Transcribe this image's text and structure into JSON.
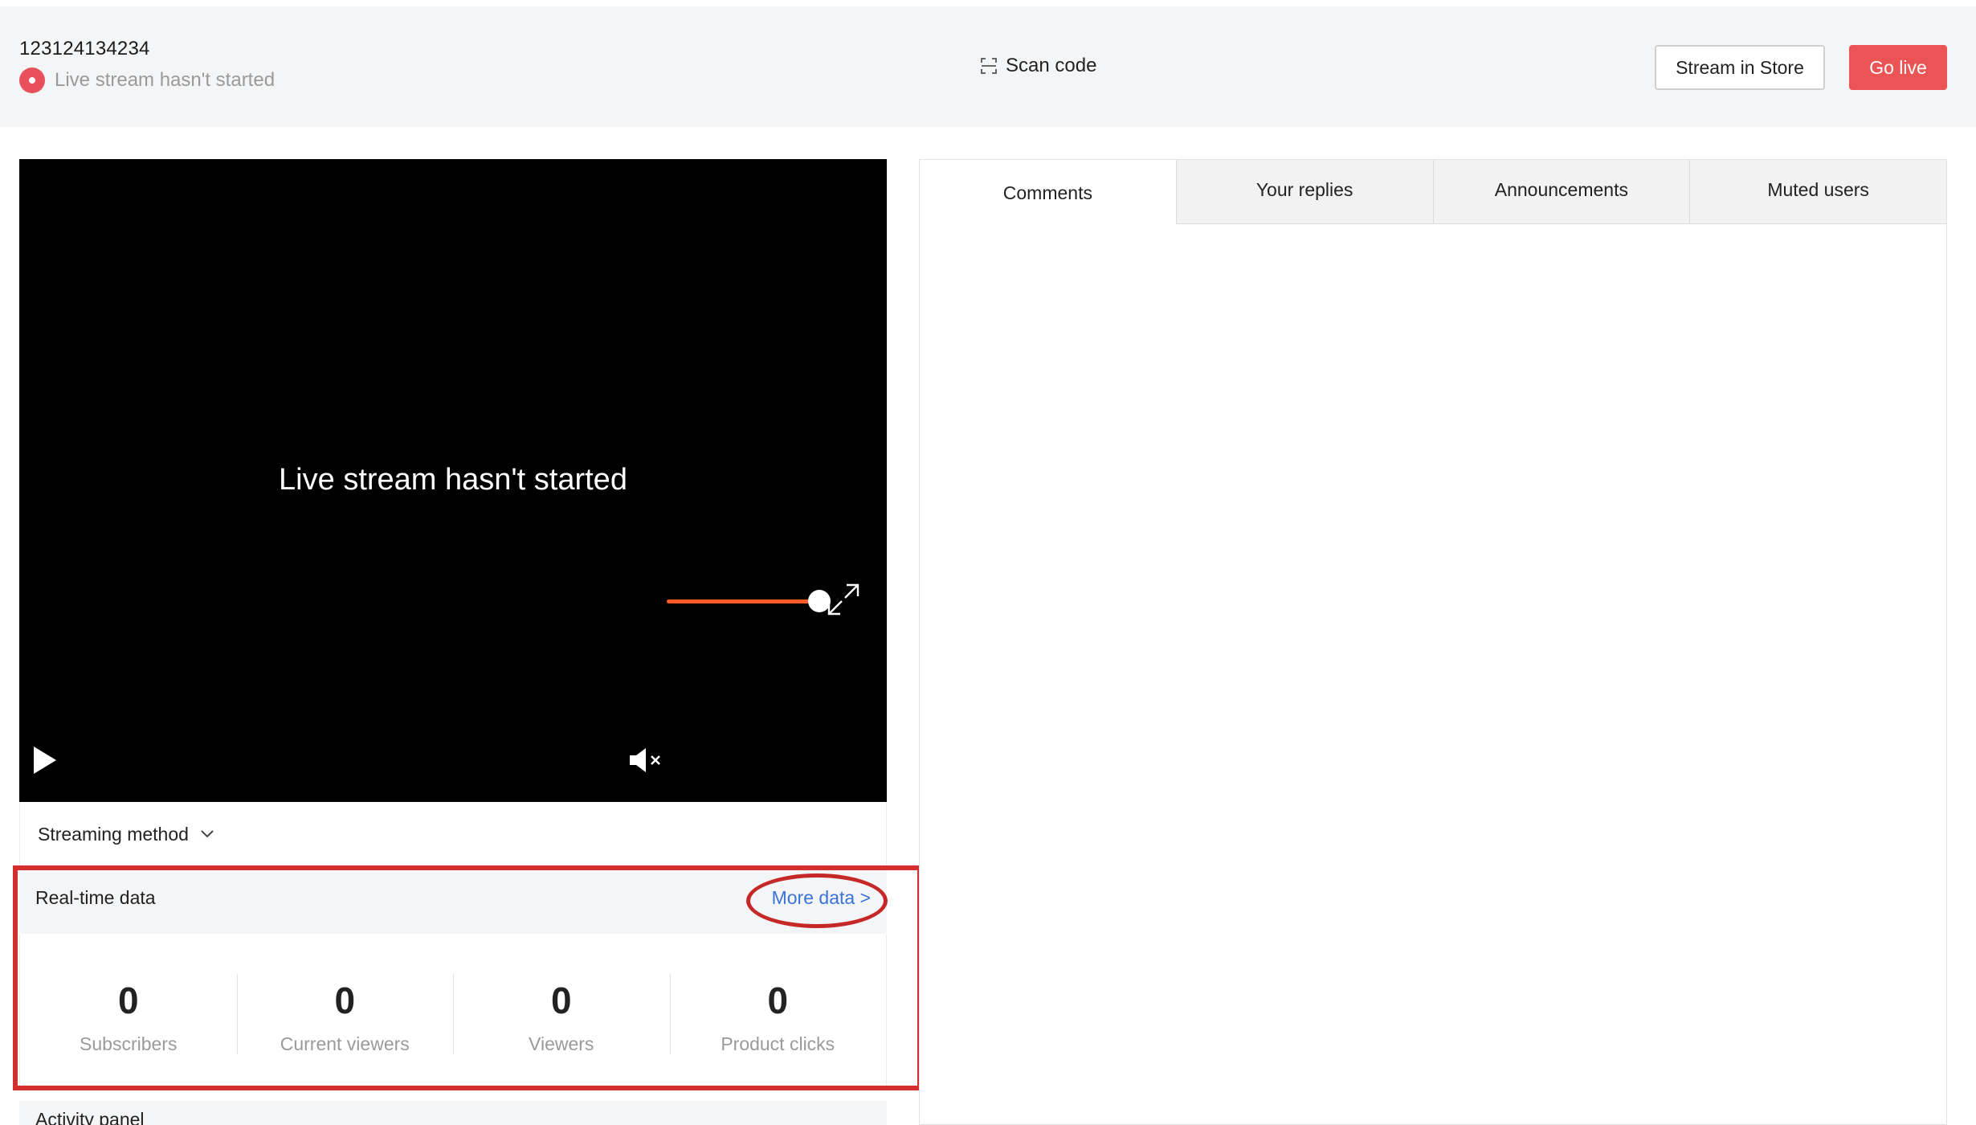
{
  "header": {
    "stream_id": "123124134234",
    "status_text": "Live stream hasn't started",
    "scan_code_label": "Scan code",
    "stream_in_store_label": "Stream in Store",
    "go_live_label": "Go live"
  },
  "player": {
    "message": "Live stream hasn't started",
    "muted": true,
    "volume_level": 1.0
  },
  "streaming_method": {
    "label": "Streaming method"
  },
  "realtime": {
    "title": "Real-time data",
    "more_label": "More data >",
    "stats": [
      {
        "value": "0",
        "label": "Subscribers"
      },
      {
        "value": "0",
        "label": "Current viewers"
      },
      {
        "value": "0",
        "label": "Viewers"
      },
      {
        "value": "0",
        "label": "Product clicks"
      }
    ]
  },
  "activity_panel": {
    "title": "Activity panel"
  },
  "tabs": [
    {
      "label": "Comments",
      "active": true
    },
    {
      "label": "Your replies",
      "active": false
    },
    {
      "label": "Announcements",
      "active": false
    },
    {
      "label": "Muted users",
      "active": false
    }
  ],
  "colors": {
    "accent_red": "#ea5455",
    "link_blue": "#3b73d9",
    "volume_orange": "#ff5a2a",
    "annotation_red": "#d32f2f"
  },
  "icons": {
    "status": "status-dot-icon",
    "scan": "scan-code-icon",
    "play": "play-icon",
    "mute": "mute-icon",
    "fullscreen": "fullscreen-icon",
    "chevron": "chevron-down-icon"
  }
}
